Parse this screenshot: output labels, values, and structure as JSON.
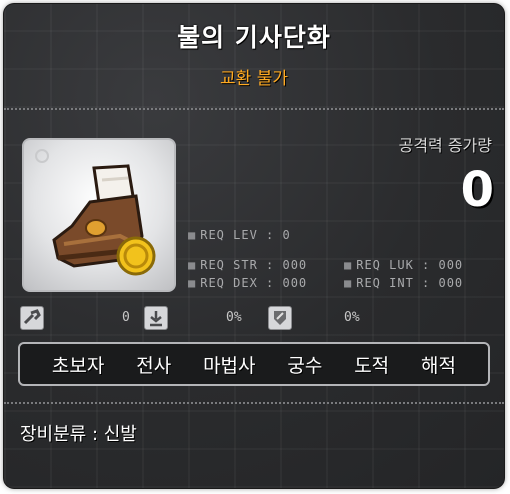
{
  "item": {
    "name": "불의 기사단화",
    "trade_status": "교환 불가",
    "icon": "brown-boot-with-gold-coin-icon"
  },
  "attack": {
    "label": "공격력 증가량",
    "value": "0"
  },
  "requirements": {
    "lev": "REQ LEV :   0",
    "str": "REQ STR : 000",
    "luk": "REQ LUK : 000",
    "dex": "REQ DEX : 000",
    "int": "REQ INT : 000"
  },
  "small_stats": {
    "first": {
      "icon": "gear-tool-icon",
      "value": "0"
    },
    "second": {
      "icon": "upgrade-hammer-icon",
      "value": "0%"
    },
    "third": {
      "icon": "shield-armor-icon",
      "value": "0%"
    }
  },
  "jobs": [
    "초보자",
    "전사",
    "마법사",
    "궁수",
    "도적",
    "해적"
  ],
  "category": "장비분류 : 신발",
  "colors": {
    "trade_status": "#ffaa22",
    "background": "#2b2c2e",
    "text": "#ffffff",
    "stat_text": "#a9aaac"
  }
}
